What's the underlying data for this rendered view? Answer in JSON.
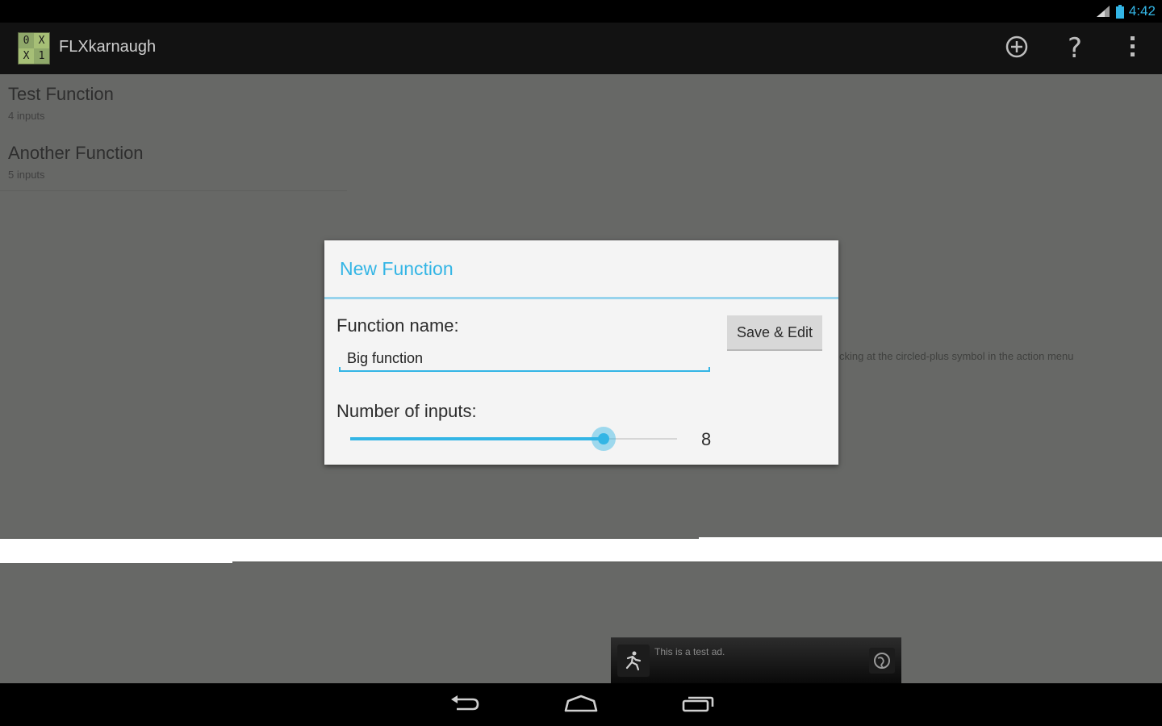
{
  "status_bar": {
    "time": "4:42",
    "icons": [
      "signal-icon",
      "battery-icon"
    ]
  },
  "action_bar": {
    "app_title": "FLXkarnaugh",
    "logo_cells": [
      "0",
      "X",
      "X",
      "1"
    ],
    "actions": [
      "add-circle-icon",
      "help-icon",
      "overflow-menu-icon"
    ],
    "help_glyph": "?"
  },
  "function_list": [
    {
      "title": "Test Function",
      "subtitle": "4 inputs"
    },
    {
      "title": "Another Function",
      "subtitle": "5 inputs"
    }
  ],
  "hint": "cking at the circled-plus symbol in the action menu",
  "dialog": {
    "title": "New Function",
    "name_label": "Function name:",
    "name_value": "Big function",
    "save_label": "Save & Edit",
    "inputs_label": "Number of inputs:",
    "inputs_value": "8",
    "slider_fraction": 0.775,
    "accent_color": "#33b5e5"
  },
  "ad": {
    "text": "This is a test ad.",
    "icons": [
      "ad-runner-icon",
      "globe-icon"
    ]
  },
  "nav_bar": {
    "buttons": [
      "back-icon",
      "home-icon",
      "recents-icon"
    ]
  }
}
